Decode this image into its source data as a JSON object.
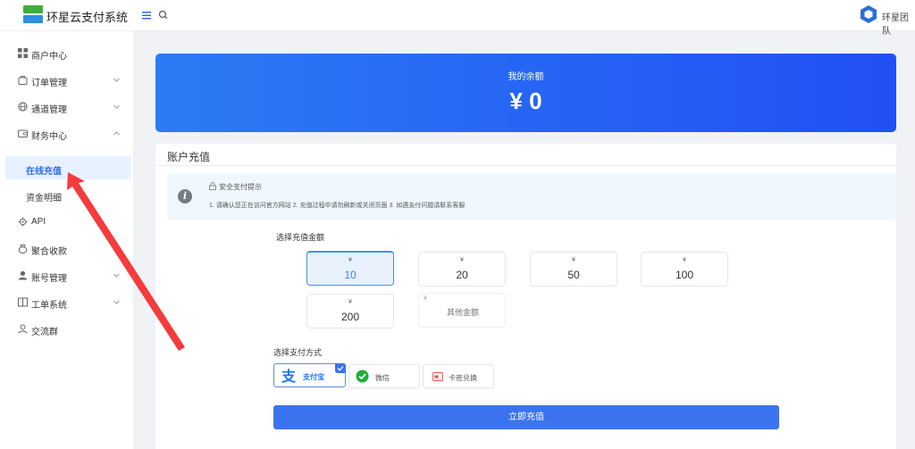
{
  "header": {
    "brand": "环星云支付系统",
    "team": "环星团队",
    "colors": {
      "logo_green": "#3cae3c",
      "team_blue": "#2a6fd6"
    }
  },
  "sidebar": {
    "items": [
      {
        "label": "商户中心",
        "icon": "grid-icon"
      },
      {
        "label": "订单管理",
        "icon": "bag-icon"
      },
      {
        "label": "通道管理",
        "icon": "globe-icon"
      },
      {
        "label": "财务中心",
        "icon": "wallet-icon"
      },
      {
        "label": "API",
        "icon": "cog-icon"
      },
      {
        "label": "聚合收款",
        "icon": "coin-bag-icon"
      },
      {
        "label": "账号管理",
        "icon": "user-icon"
      },
      {
        "label": "工单系统",
        "icon": "book-icon"
      },
      {
        "label": "交流群",
        "icon": "user-outline-icon"
      }
    ],
    "finance_sub": [
      {
        "label": "在线充值",
        "active": true
      },
      {
        "label": "资金明细",
        "active": false
      }
    ]
  },
  "balance": {
    "title": "我的余额",
    "amount": "¥ 0",
    "gradient": [
      "#2d7bf4",
      "#2150f5"
    ]
  },
  "recharge": {
    "title": "账户充值",
    "tip": {
      "title": "安全支付提示",
      "text": "1. 请确认您正在访问官方网站 2. 充值过程中请勿刷新或关闭页面 3. 如遇支付问题请联系客服"
    },
    "amount_label": "选择充值金额",
    "currency": "¥",
    "amounts": [
      {
        "value": "10",
        "selected": true
      },
      {
        "value": "20",
        "selected": false
      },
      {
        "value": "50",
        "selected": false
      },
      {
        "value": "100",
        "selected": false
      },
      {
        "value": "200",
        "selected": false
      }
    ],
    "custom_placeholder": "其他金额",
    "pay_label": "选择支付方式",
    "pay_methods": [
      {
        "label": "支付宝",
        "icon": "alipay-icon",
        "selected": true
      },
      {
        "label": "微信",
        "icon": "wechat-icon",
        "selected": false
      },
      {
        "label": "卡密兑换",
        "icon": "card-icon",
        "selected": false
      }
    ],
    "submit_label": "立即充值",
    "accent": "#3b74ee"
  }
}
